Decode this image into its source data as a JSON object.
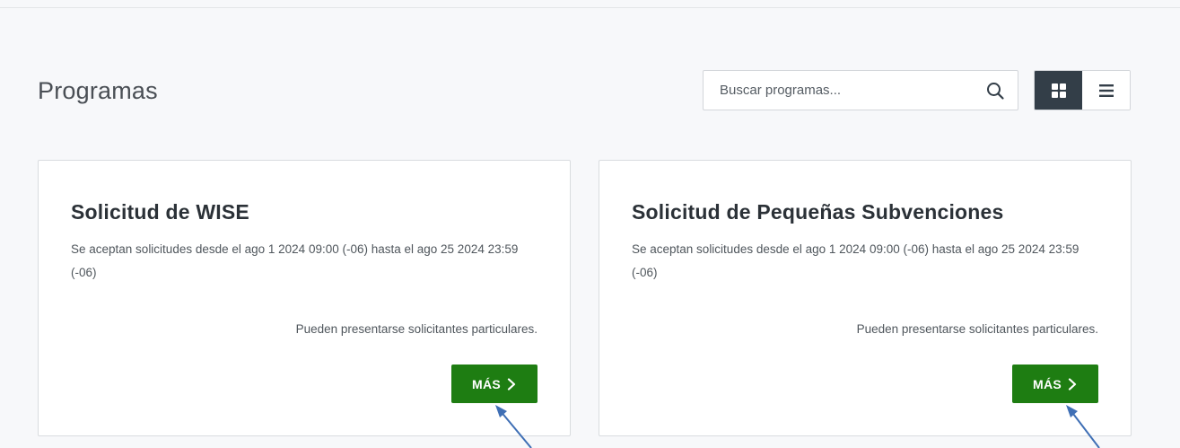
{
  "header": {
    "title": "Programas"
  },
  "search": {
    "placeholder": "Buscar programas...",
    "value": ""
  },
  "view_toggle": {
    "active": "grid",
    "options": [
      "grid-view-icon",
      "list-view-icon"
    ]
  },
  "programs": [
    {
      "title": "Solicitud de WISE",
      "description": "Se aceptan solicitudes desde el ago 1 2024 09:00 (-06) hasta el ago 25 2024 23:59 (-06)",
      "eligibility": "Pueden presentarse solicitantes particulares.",
      "button_label": "MÁS"
    },
    {
      "title": "Solicitud de Pequeñas Subvenciones",
      "description": "Se aceptan solicitudes desde el ago 1 2024 09:00 (-06) hasta el ago 25 2024 23:59 (-06)",
      "eligibility": "Pueden presentarse solicitantes particulares.",
      "button_label": "MÁS"
    }
  ],
  "colors": {
    "primary_button": "#1e7d12",
    "toggle_active": "#333e48",
    "annotation_arrow": "#3f6fb5",
    "background": "#f7f8fa"
  }
}
